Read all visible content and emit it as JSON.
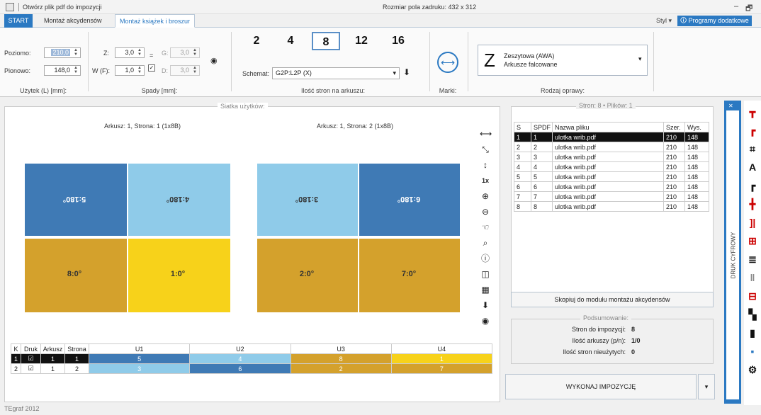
{
  "titlebar": {
    "open_label": "Otwórz plik pdf do impozycji",
    "print_field": "Rozmiar pola zadruku: 432 x 312",
    "minimize": "–",
    "restore": "🗗"
  },
  "tabs": {
    "start": "START",
    "akcydensow": "Montaż akcydensów",
    "ksiazek": "Montaż książek i broszur",
    "styl": "Styl ▾",
    "programy": "🛈 Programy dodatkowe"
  },
  "uzytek": {
    "poziomo_label": "Poziomo:",
    "poziomo_value": "210,0",
    "pionowo_label": "Pionowo:",
    "pionowo_value": "148,0",
    "group_label": "Użytek (L) [mm]:"
  },
  "spady": {
    "z_label": "Z:",
    "z_value": "3,0",
    "wf_label": "W (F):",
    "wf_value": "1,0",
    "g_label": "G:",
    "g_value": "3,0",
    "d_label": "D:",
    "d_value": "3,0",
    "eq": "=",
    "group_label": "Spady [mm]:"
  },
  "strony": {
    "options": [
      "2",
      "4",
      "8",
      "12",
      "16"
    ],
    "selected": "8",
    "schemat_label": "Schemat:",
    "schemat_value": "G2P:L2P (X)",
    "group_label": "Ilość stron na arkuszu:"
  },
  "marki": {
    "group_label": "Marki:"
  },
  "oprawa": {
    "letter": "Z",
    "line1": "Zeszytowa (AWA)",
    "line2": "Arkusze falcowane",
    "group_label": "Rodzaj oprawy:"
  },
  "main": {
    "legend": "Siatka użytków:",
    "sheet1_title": "Arkusz: 1, Strona: 1 (1x8B)",
    "sheet2_title": "Arkusz: 1, Strona: 2 (1x8B)",
    "sheet1_pages": [
      "5:180°",
      "4:180°",
      "8:0°",
      "1:0°"
    ],
    "sheet2_pages": [
      "3:180°",
      "6:180°",
      "2:0°",
      "7:0°"
    ],
    "tool_1x": "1x"
  },
  "grid_table": {
    "headers": [
      "K",
      "Druk",
      "Arkusz",
      "Strona",
      "U1",
      "U2",
      "U3",
      "U4"
    ],
    "rows": [
      {
        "k": "1",
        "druk": "☑",
        "arkusz": "1",
        "strona": "1",
        "u": [
          "5",
          "4",
          "8",
          "1"
        ]
      },
      {
        "k": "2",
        "druk": "☑",
        "arkusz": "1",
        "strona": "2",
        "u": [
          "3",
          "6",
          "2",
          "7"
        ]
      }
    ]
  },
  "files": {
    "legend": "Stron: 8 • Plików: 1",
    "headers": [
      "S",
      "SPDF",
      "Nazwa pliku",
      "Szer.",
      "Wys."
    ],
    "rows": [
      [
        "1",
        "1",
        "ulotka wrib.pdf",
        "210",
        "148"
      ],
      [
        "2",
        "2",
        "ulotka wrib.pdf",
        "210",
        "148"
      ],
      [
        "3",
        "3",
        "ulotka wrib.pdf",
        "210",
        "148"
      ],
      [
        "4",
        "4",
        "ulotka wrib.pdf",
        "210",
        "148"
      ],
      [
        "5",
        "5",
        "ulotka wrib.pdf",
        "210",
        "148"
      ],
      [
        "6",
        "6",
        "ulotka wrib.pdf",
        "210",
        "148"
      ],
      [
        "7",
        "7",
        "ulotka wrib.pdf",
        "210",
        "148"
      ],
      [
        "8",
        "8",
        "ulotka wrib.pdf",
        "210",
        "148"
      ]
    ],
    "copy_button": "Skopiuj do modułu montażu akcydensów",
    "summary_legend": "Podsumowanie:",
    "summary": [
      {
        "label": "Stron do impozycji:",
        "value": "8"
      },
      {
        "label": "Ilość arkuszy (p/n):",
        "value": "1/0"
      },
      {
        "label": "Ilość stron nieużytych:",
        "value": "0"
      }
    ],
    "execute_button": "WYKONAJ IMPOZYCJĘ"
  },
  "side_panel": {
    "druk_label": "DRUK CYFROWY"
  },
  "status": "TEgraf 2012",
  "colors": {
    "accent": "#2b79c2",
    "blue_dark": "#3f7ab5",
    "blue_light": "#8fcbe9",
    "gold": "#d4a12c",
    "yellow": "#f7d21a"
  }
}
